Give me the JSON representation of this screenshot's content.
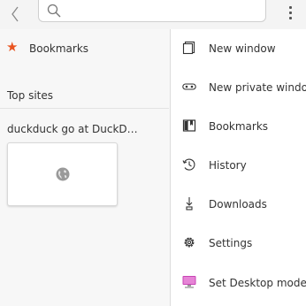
{
  "toolbar": {
    "back": "back",
    "search_placeholder": ""
  },
  "left": {
    "bookmarks_label": "Bookmarks",
    "top_sites_label": "Top sites",
    "site_title": "duckduck go at DuckD…"
  },
  "menu": {
    "items": [
      {
        "label": "New window",
        "icon": "new-window-icon"
      },
      {
        "label": "New private window",
        "icon": "private-window-icon"
      },
      {
        "label": "Bookmarks",
        "icon": "bookmarks-icon"
      },
      {
        "label": "History",
        "icon": "history-icon"
      },
      {
        "label": "Downloads",
        "icon": "downloads-icon"
      },
      {
        "label": "Settings",
        "icon": "settings-icon"
      },
      {
        "label": "Set Desktop mode",
        "icon": "desktop-mode-icon"
      }
    ]
  },
  "colors": {
    "accent": "#e95420"
  }
}
